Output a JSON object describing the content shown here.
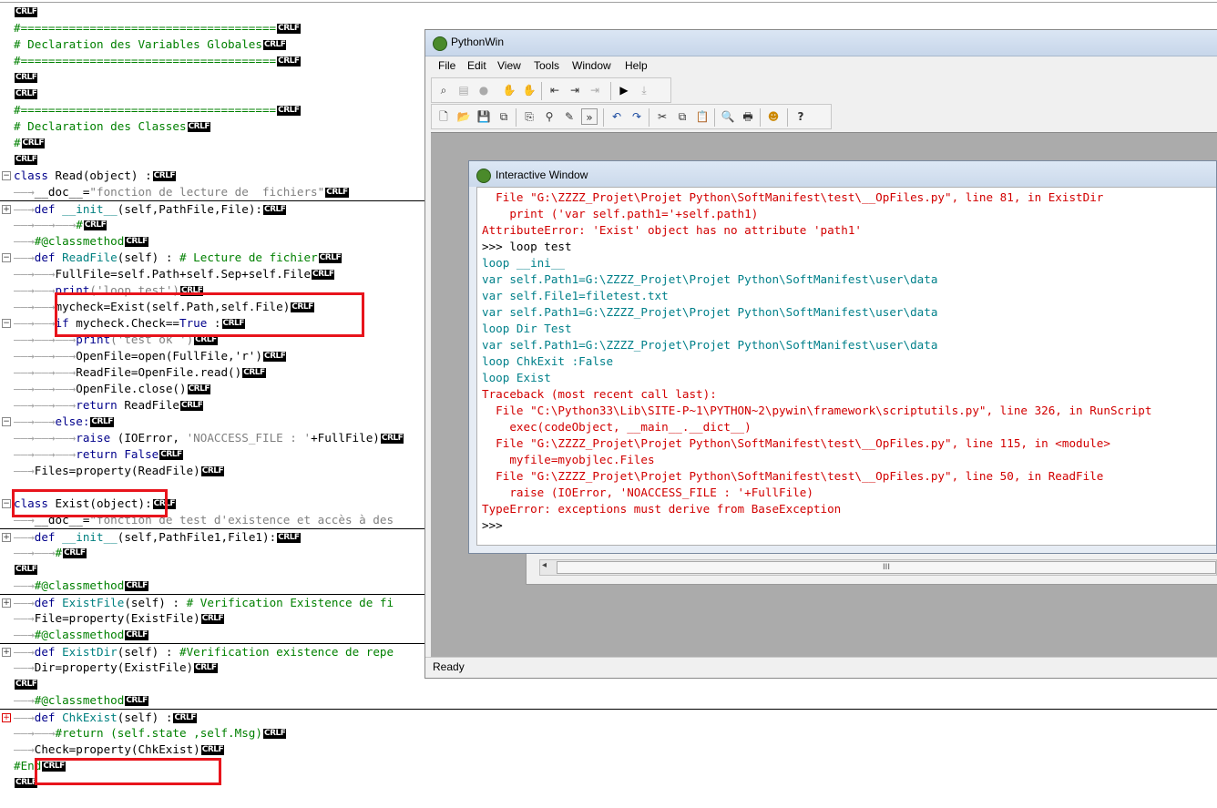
{
  "editor": {
    "crlf": "CRLF",
    "lines": [
      {
        "segs": [],
        "fold": ""
      },
      {
        "segs": [
          {
            "t": "#=====================================",
            "c": "c-green"
          }
        ],
        "fold": ""
      },
      {
        "segs": [
          {
            "t": "# Declaration des Variables Globales",
            "c": "c-green"
          }
        ],
        "fold": ""
      },
      {
        "segs": [
          {
            "t": "#=====================================",
            "c": "c-green"
          }
        ],
        "fold": ""
      },
      {
        "segs": [],
        "fold": ""
      },
      {
        "segs": [],
        "fold": ""
      },
      {
        "segs": [
          {
            "t": "#=====================================",
            "c": "c-green"
          }
        ],
        "fold": ""
      },
      {
        "segs": [
          {
            "t": "# Declaration des Classes",
            "c": "c-green"
          }
        ],
        "fold": ""
      },
      {
        "segs": [
          {
            "t": "#",
            "c": "c-green"
          }
        ],
        "fold": ""
      },
      {
        "segs": [],
        "fold": ""
      },
      {
        "segs": [
          {
            "t": "class ",
            "c": "c-kw"
          },
          {
            "t": "Read(object) :",
            "c": ""
          }
        ],
        "fold": "-"
      },
      {
        "segs": [
          {
            "t": "——→",
            "c": "c-arrow"
          },
          {
            "t": "__doc__=",
            "c": ""
          },
          {
            "t": "\"fonction de lecture de  fichiers\"",
            "c": "c-str"
          }
        ],
        "fold": ""
      },
      {
        "segs": [
          {
            "t": "——→",
            "c": "c-arrow"
          },
          {
            "t": "def ",
            "c": "c-kw"
          },
          {
            "t": "__init__",
            "c": "c-fn"
          },
          {
            "t": "(self,PathFile,File):",
            "c": ""
          }
        ],
        "fold": "+",
        "sep": true
      },
      {
        "segs": [
          {
            "t": "——→——→——→",
            "c": "c-arrow"
          },
          {
            "t": "#",
            "c": "c-green"
          }
        ],
        "fold": ""
      },
      {
        "segs": [
          {
            "t": "——→",
            "c": "c-arrow"
          },
          {
            "t": "#@classmethod",
            "c": "c-green"
          }
        ],
        "fold": ""
      },
      {
        "segs": [
          {
            "t": "——→",
            "c": "c-arrow"
          },
          {
            "t": "def ",
            "c": "c-kw"
          },
          {
            "t": "ReadFile",
            "c": "c-fn"
          },
          {
            "t": "(self) : ",
            "c": ""
          },
          {
            "t": "# Lecture de fichier",
            "c": "c-green"
          }
        ],
        "fold": "-"
      },
      {
        "segs": [
          {
            "t": "——→——→",
            "c": "c-arrow"
          },
          {
            "t": "FullFile=self.Path+self.Sep+self.File",
            "c": ""
          }
        ],
        "fold": ""
      },
      {
        "segs": [
          {
            "t": "——→——→",
            "c": "c-arrow"
          },
          {
            "t": "print",
            "c": "c-kw"
          },
          {
            "t": "('loop test')",
            "c": "c-str"
          }
        ],
        "fold": ""
      },
      {
        "segs": [
          {
            "t": "——→——→",
            "c": "c-arrow"
          },
          {
            "t": "mycheck=Exist(self.Path,self.File)",
            "c": ""
          }
        ],
        "fold": ""
      },
      {
        "segs": [
          {
            "t": "——→——→",
            "c": "c-arrow"
          },
          {
            "t": "if ",
            "c": "c-kw"
          },
          {
            "t": "mycheck.Check==",
            "c": ""
          },
          {
            "t": "True",
            "c": "c-kw"
          },
          {
            "t": " :",
            "c": ""
          }
        ],
        "fold": "-"
      },
      {
        "segs": [
          {
            "t": "——→——→——→",
            "c": "c-arrow"
          },
          {
            "t": "print",
            "c": "c-kw"
          },
          {
            "t": "('test ok ')",
            "c": "c-str"
          }
        ],
        "fold": ""
      },
      {
        "segs": [
          {
            "t": "——→——→——→",
            "c": "c-arrow"
          },
          {
            "t": "OpenFile=open(FullFile,'r')",
            "c": ""
          }
        ],
        "fold": ""
      },
      {
        "segs": [
          {
            "t": "——→——→——→",
            "c": "c-arrow"
          },
          {
            "t": "ReadFile=OpenFile.read()",
            "c": ""
          }
        ],
        "fold": ""
      },
      {
        "segs": [
          {
            "t": "——→——→——→",
            "c": "c-arrow"
          },
          {
            "t": "OpenFile.close()",
            "c": ""
          }
        ],
        "fold": ""
      },
      {
        "segs": [
          {
            "t": "——→——→——→",
            "c": "c-arrow"
          },
          {
            "t": "return ",
            "c": "c-kw"
          },
          {
            "t": "ReadFile",
            "c": ""
          }
        ],
        "fold": ""
      },
      {
        "segs": [
          {
            "t": "——→——→",
            "c": "c-arrow"
          },
          {
            "t": "else:",
            "c": "c-kw"
          }
        ],
        "fold": "-"
      },
      {
        "segs": [
          {
            "t": "——→——→——→",
            "c": "c-arrow"
          },
          {
            "t": "raise ",
            "c": "c-kw"
          },
          {
            "t": "(IOError, ",
            "c": ""
          },
          {
            "t": "'NOACCESS_FILE : '",
            "c": "c-str"
          },
          {
            "t": "+FullFile)",
            "c": ""
          }
        ],
        "fold": ""
      },
      {
        "segs": [
          {
            "t": "——→——→——→",
            "c": "c-arrow"
          },
          {
            "t": "return ",
            "c": "c-kw"
          },
          {
            "t": "False",
            "c": "c-kw"
          }
        ],
        "fold": ""
      },
      {
        "segs": [
          {
            "t": "——→",
            "c": "c-arrow"
          },
          {
            "t": "Files=property(ReadFile)",
            "c": ""
          }
        ],
        "fold": ""
      },
      {
        "segs": [],
        "fold": "",
        "nocr": true
      },
      {
        "segs": [
          {
            "t": "class ",
            "c": "c-kw"
          },
          {
            "t": "Exist(object):",
            "c": ""
          }
        ],
        "fold": "-"
      },
      {
        "segs": [
          {
            "t": "——→",
            "c": "c-arrow"
          },
          {
            "t": "__doc__=",
            "c": ""
          },
          {
            "t": "\"fonction de test d'existence et accès à des",
            "c": "c-str"
          }
        ],
        "fold": "",
        "nocr": true
      },
      {
        "segs": [
          {
            "t": "——→",
            "c": "c-arrow"
          },
          {
            "t": "def ",
            "c": "c-kw"
          },
          {
            "t": "__init__",
            "c": "c-fn"
          },
          {
            "t": "(self,PathFile1,File1):",
            "c": ""
          }
        ],
        "fold": "+",
        "sep": true
      },
      {
        "segs": [
          {
            "t": "——→——→",
            "c": "c-arrow"
          },
          {
            "t": "#",
            "c": "c-green"
          }
        ],
        "fold": ""
      },
      {
        "segs": [],
        "fold": ""
      },
      {
        "segs": [
          {
            "t": "——→",
            "c": "c-arrow"
          },
          {
            "t": "#@classmethod",
            "c": "c-green"
          }
        ],
        "fold": ""
      },
      {
        "segs": [
          {
            "t": "——→",
            "c": "c-arrow"
          },
          {
            "t": "def ",
            "c": "c-kw"
          },
          {
            "t": "ExistFile",
            "c": "c-fn"
          },
          {
            "t": "(self) : ",
            "c": ""
          },
          {
            "t": "# Verification Existence de fi",
            "c": "c-green"
          }
        ],
        "fold": "+",
        "sep": true,
        "nocr": true
      },
      {
        "segs": [
          {
            "t": "——→",
            "c": "c-arrow"
          },
          {
            "t": "File=property(ExistFile)",
            "c": ""
          }
        ],
        "fold": ""
      },
      {
        "segs": [
          {
            "t": "——→",
            "c": "c-arrow"
          },
          {
            "t": "#@classmethod",
            "c": "c-green"
          }
        ],
        "fold": ""
      },
      {
        "segs": [
          {
            "t": "——→",
            "c": "c-arrow"
          },
          {
            "t": "def ",
            "c": "c-kw"
          },
          {
            "t": "ExistDir",
            "c": "c-fn"
          },
          {
            "t": "(self) : ",
            "c": ""
          },
          {
            "t": "#Verification existence de repe",
            "c": "c-green"
          }
        ],
        "fold": "+",
        "sep": true,
        "nocr": true
      },
      {
        "segs": [
          {
            "t": "——→",
            "c": "c-arrow"
          },
          {
            "t": "Dir=property(ExistFile)",
            "c": ""
          }
        ],
        "fold": ""
      },
      {
        "segs": [],
        "fold": ""
      },
      {
        "segs": [
          {
            "t": "——→",
            "c": "c-arrow"
          },
          {
            "t": "#@classmethod",
            "c": "c-green"
          }
        ],
        "fold": ""
      },
      {
        "segs": [
          {
            "t": "——→",
            "c": "c-arrow"
          },
          {
            "t": "def ",
            "c": "c-kw"
          },
          {
            "t": "ChkExist",
            "c": "c-fn"
          },
          {
            "t": "(self) :",
            "c": ""
          }
        ],
        "fold": "+r",
        "sep": true
      },
      {
        "segs": [
          {
            "t": "——→——→",
            "c": "c-arrow"
          },
          {
            "t": "#return (self.state ,self.Msg)",
            "c": "c-green"
          }
        ],
        "fold": ""
      },
      {
        "segs": [
          {
            "t": "——→",
            "c": "c-arrow"
          },
          {
            "t": "Check=property(ChkExist)",
            "c": ""
          }
        ],
        "fold": ""
      },
      {
        "segs": [
          {
            "t": "#End",
            "c": "c-green"
          }
        ],
        "fold": ""
      },
      {
        "segs": [],
        "fold": ""
      }
    ]
  },
  "pythonwin": {
    "title": "PythonWin",
    "menu": [
      "File",
      "Edit",
      "View",
      "Tools",
      "Window",
      "Help"
    ],
    "toolbar1": [
      "⌕",
      "▤",
      "●",
      "✋",
      "✋",
      "⇤",
      "⇥",
      "⇥",
      "▶",
      "⤓"
    ],
    "toolbar2": [
      "🗋",
      "📂",
      "💾",
      "⧉",
      "⎘",
      "⚲",
      "✎",
      "»",
      "↶",
      "↷",
      "✂",
      "⧉",
      "📋",
      "🔍",
      "🖶",
      "☻",
      "?"
    ],
    "status": "Ready"
  },
  "interactive": {
    "title": "Interactive Window",
    "lines": [
      {
        "t": "  File \"G:\\ZZZZ_Projet\\Projet Python\\SoftManifest\\test\\__OpFiles.py\", line 81, in ExistDir",
        "c": "red"
      },
      {
        "t": "    print ('var self.path1='+self.path1)",
        "c": "red"
      },
      {
        "t": "AttributeError: 'Exist' object has no attribute 'path1'",
        "c": "red"
      },
      {
        "t": ">>> loop test",
        "c": "black"
      },
      {
        "t": "loop __ini__",
        "c": "teal"
      },
      {
        "t": "var self.Path1=G:\\ZZZZ_Projet\\Projet Python\\SoftManifest\\user\\data",
        "c": "teal"
      },
      {
        "t": "var self.File1=filetest.txt",
        "c": "teal"
      },
      {
        "t": "var self.Path1=G:\\ZZZZ_Projet\\Projet Python\\SoftManifest\\user\\data",
        "c": "teal"
      },
      {
        "t": "loop Dir Test",
        "c": "teal"
      },
      {
        "t": "var self.Path1=G:\\ZZZZ_Projet\\Projet Python\\SoftManifest\\user\\data",
        "c": "teal"
      },
      {
        "t": "loop ChkExit :False",
        "c": "teal"
      },
      {
        "t": "loop Exist",
        "c": "teal"
      },
      {
        "t": "Traceback (most recent call last):",
        "c": "red"
      },
      {
        "t": "  File \"C:\\Python33\\Lib\\SITE-P~1\\PYTHON~2\\pywin\\framework\\scriptutils.py\", line 326, in RunScript",
        "c": "red"
      },
      {
        "t": "    exec(codeObject, __main__.__dict__)",
        "c": "red"
      },
      {
        "t": "  File \"G:\\ZZZZ_Projet\\Projet Python\\SoftManifest\\test\\__OpFiles.py\", line 115, in <module>",
        "c": "red"
      },
      {
        "t": "    myfile=myobjlec.Files",
        "c": "red"
      },
      {
        "t": "  File \"G:\\ZZZZ_Projet\\Projet Python\\SoftManifest\\test\\__OpFiles.py\", line 50, in ReadFile",
        "c": "red"
      },
      {
        "t": "    raise (IOError, 'NOACCESS_FILE : '+FullFile)",
        "c": "red"
      },
      {
        "t": "TypeError: exceptions must derive from BaseException",
        "c": "red"
      },
      {
        "t": ">>>",
        "c": "black"
      }
    ]
  },
  "backwindow": {
    "scroll_thumb": "III"
  }
}
